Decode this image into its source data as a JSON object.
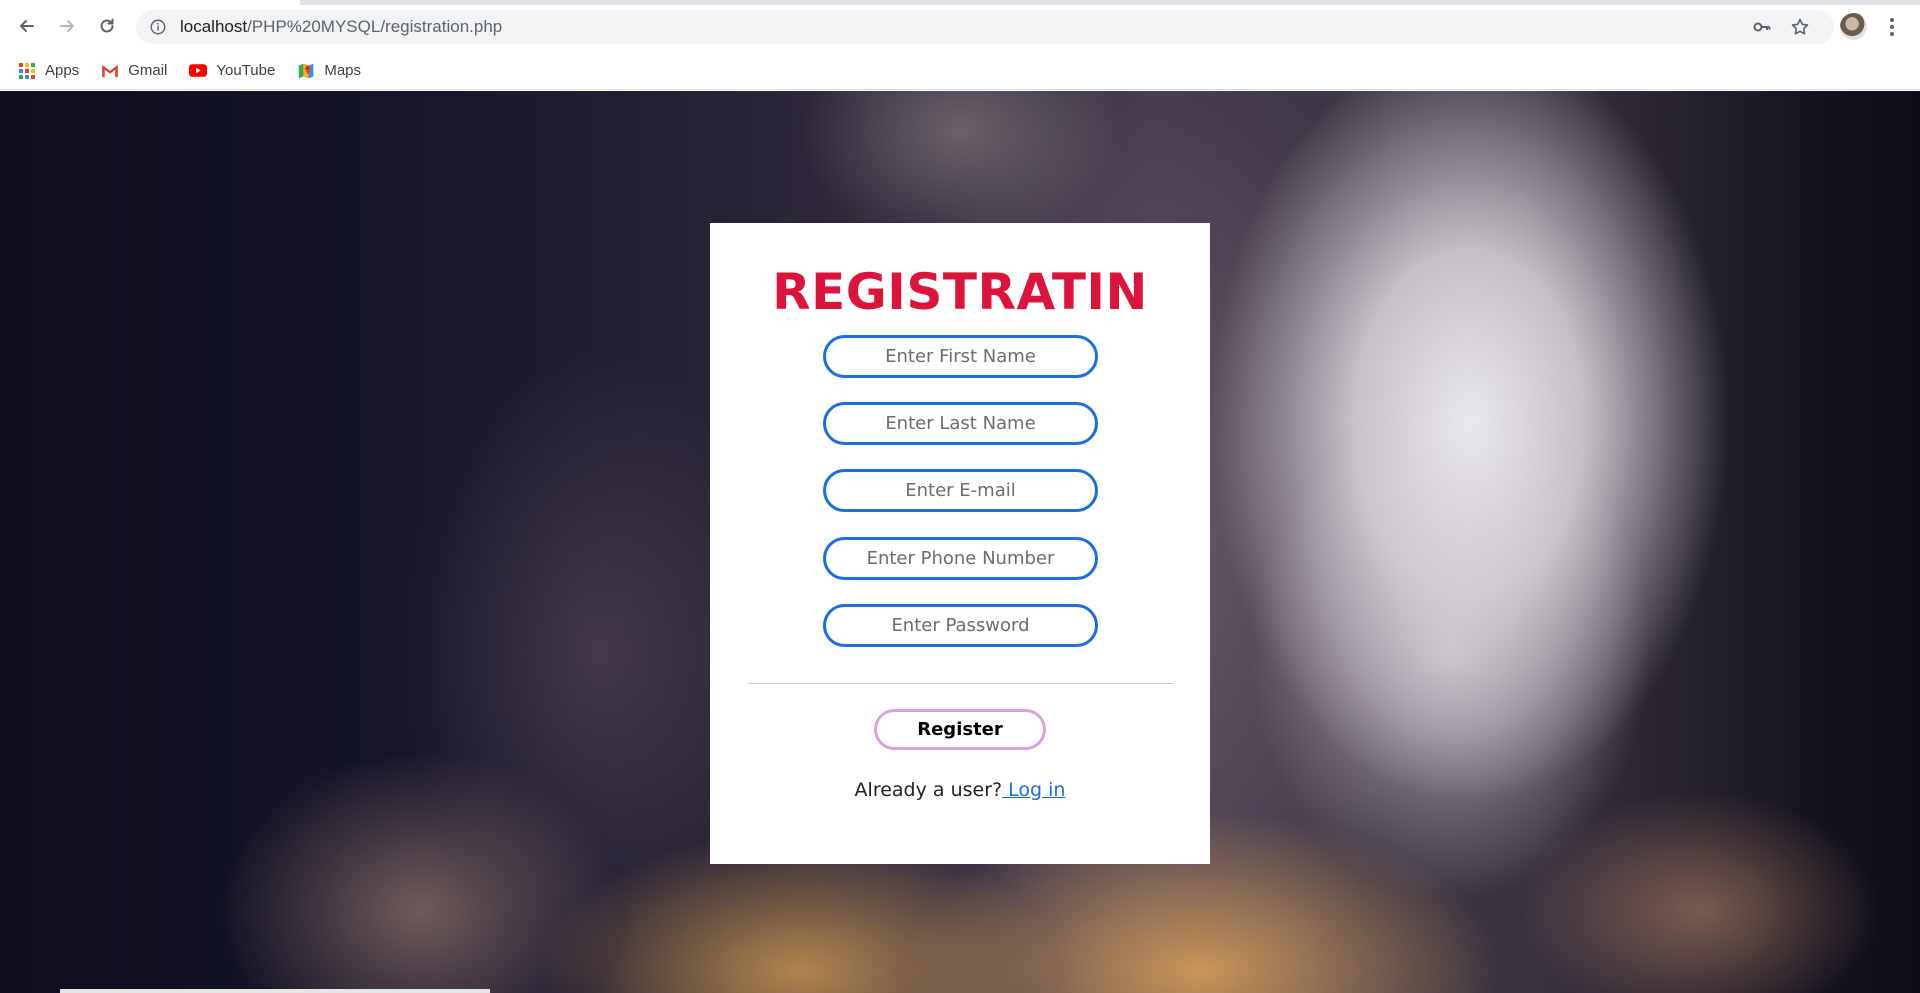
{
  "browser": {
    "url_host": "localhost",
    "url_path": "/PHP%20MYSQL/registration.php",
    "bookmarks": [
      {
        "label": "Apps",
        "icon": "apps-grid-icon"
      },
      {
        "label": "Gmail",
        "icon": "gmail-icon"
      },
      {
        "label": "YouTube",
        "icon": "youtube-icon"
      },
      {
        "label": "Maps",
        "icon": "maps-icon"
      }
    ]
  },
  "form": {
    "title": "REGISTRATIN",
    "fields": [
      {
        "placeholder": "Enter First Name",
        "value": ""
      },
      {
        "placeholder": "Enter Last Name",
        "value": ""
      },
      {
        "placeholder": "Enter E-mail",
        "value": ""
      },
      {
        "placeholder": "Enter Phone Number",
        "value": ""
      },
      {
        "placeholder": "Enter Password",
        "value": ""
      }
    ],
    "register_label": "Register",
    "already_text": "Already a user?",
    "login_label": " Log in"
  },
  "colors": {
    "title": "#dc143c",
    "field_border": "#1a6fe0",
    "button_border": "#dda0dd",
    "link": "#1a6fe0"
  }
}
